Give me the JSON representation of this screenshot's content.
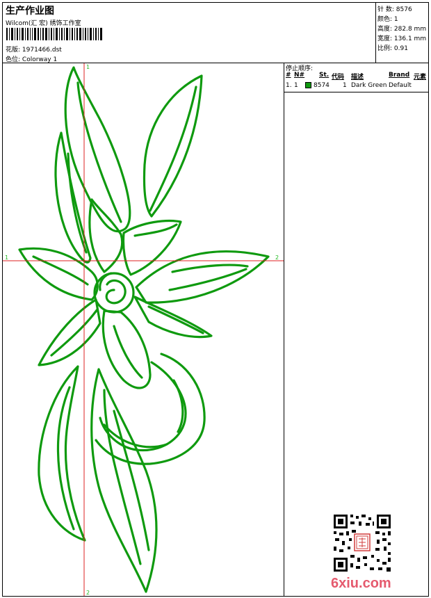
{
  "header": {
    "title": "生产作业图",
    "studio": "Wilcom(汇 宏) 绣饰工作室",
    "design_label": "花版:",
    "design_file": "1971466.dst",
    "color_label": "色位:",
    "colorway": "Colorway 1"
  },
  "stats": {
    "stitches_label": "针 数:",
    "stitches": "8576",
    "colors_label": "颜色:",
    "colors": "1",
    "height_label": "高度:",
    "height": "282.8 mm",
    "width_label": "宽度:",
    "width": "136.1 mm",
    "ratio_label": "比例:",
    "ratio": "0.91"
  },
  "stop_sequence": {
    "title": "停止顺序:",
    "columns": [
      "#",
      "N#",
      "St.",
      "代码",
      "描述",
      "Brand",
      "元素"
    ],
    "rows": [
      {
        "index": "1.",
        "needle": "1",
        "code": "8574",
        "stitches": "1",
        "description": "Dark Green",
        "brand": "Default"
      }
    ]
  },
  "axes": {
    "h_start": "1",
    "h_end": "2",
    "v_start": "1",
    "v_end": "2"
  },
  "colors": {
    "thread": "#0f9a0f",
    "axis": "#dd2222",
    "axis_label": "#22bb22",
    "watermark": "#e55a6e"
  },
  "watermark": "6xiu.com"
}
